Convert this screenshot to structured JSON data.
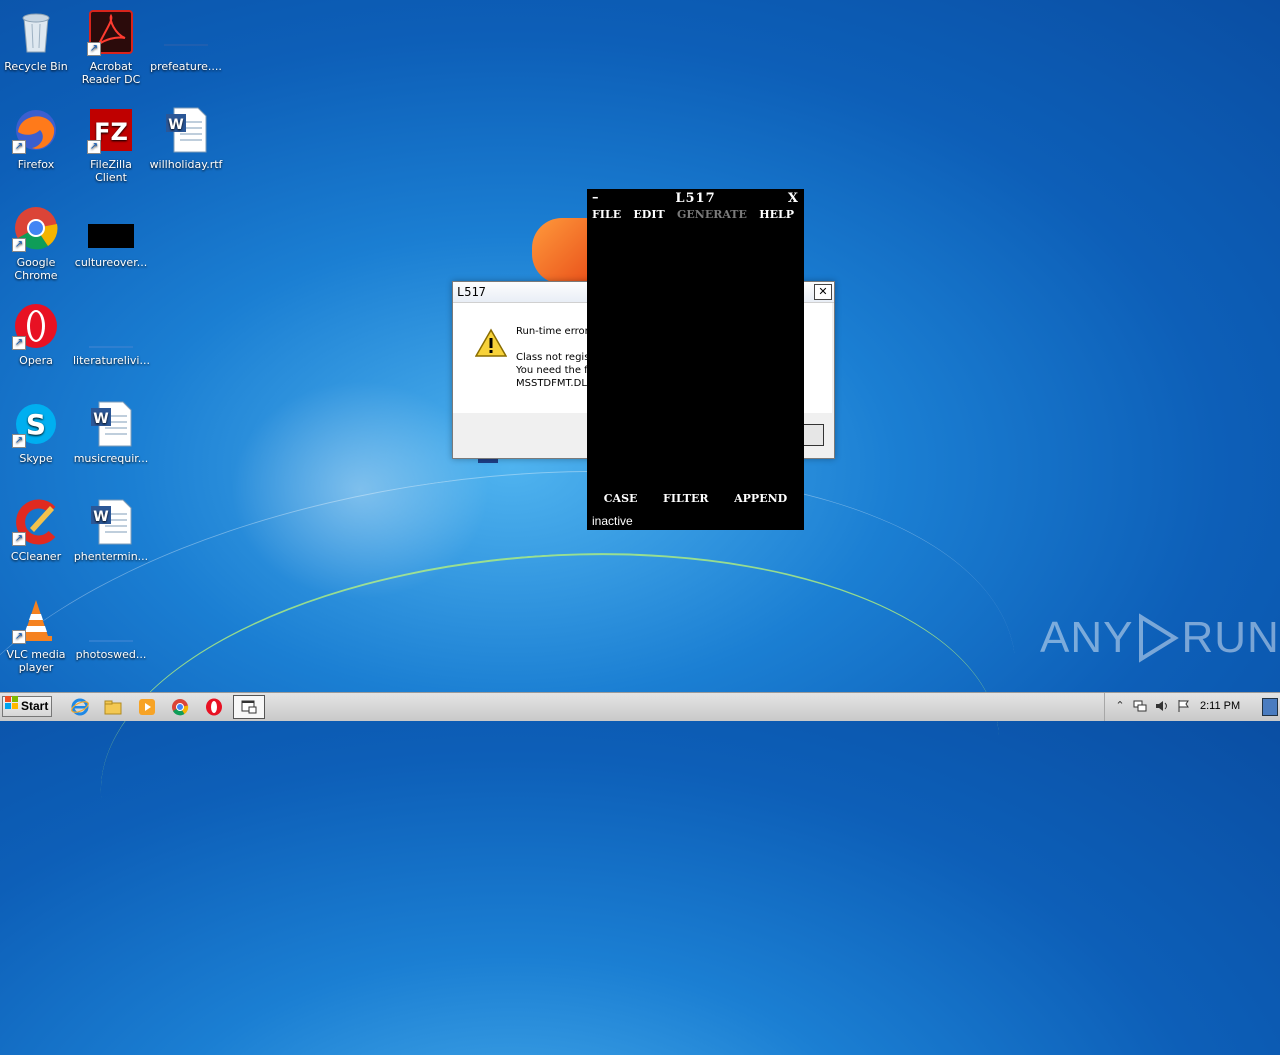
{
  "desktop": {
    "icons": [
      {
        "label": "Recycle Bin"
      },
      {
        "label": "Acrobat Reader DC"
      },
      {
        "label": "prefeature...."
      },
      {
        "label": "Firefox"
      },
      {
        "label": "FileZilla Client"
      },
      {
        "label": "willholiday.rtf"
      },
      {
        "label": "Google Chrome"
      },
      {
        "label": "cultureover..."
      },
      {
        "label": "Opera"
      },
      {
        "label": "literaturelivi..."
      },
      {
        "label": "Skype"
      },
      {
        "label": "musicrequir..."
      },
      {
        "label": "CCleaner"
      },
      {
        "label": "phentermin..."
      },
      {
        "label": "VLC media player"
      },
      {
        "label": "photoswed..."
      }
    ]
  },
  "error_dialog": {
    "title": "L517",
    "close_glyph": "✕",
    "message": "Run-time error\n\nClass not regis\nYou need the f\nMSSTDFMT.DLL"
  },
  "app_window": {
    "minimize_glyph": "–",
    "title": "L517",
    "close_glyph": "X",
    "menu": {
      "file": "FILE",
      "edit": "EDIT",
      "generate": "GENERATE",
      "help": "HELP"
    },
    "buttons": {
      "case": "CASE",
      "filter": "FILTER",
      "append": "APPEND"
    },
    "status": "inactive"
  },
  "watermark": {
    "left": "ANY",
    "right": "RUN"
  },
  "taskbar": {
    "start_label": "Start",
    "clock": "2:11 PM"
  },
  "colors": {
    "accent_blue": "#0d5fb8",
    "app_bg": "#000000",
    "menu_disabled": "#7a7a7a"
  }
}
